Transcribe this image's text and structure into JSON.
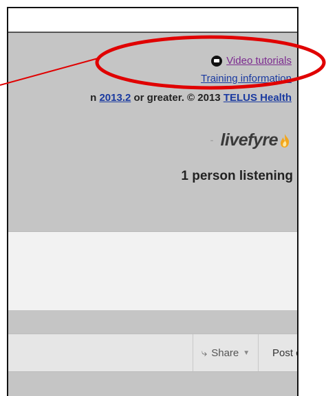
{
  "links": {
    "video_tutorials": "Video tutorials",
    "training_information": "Training information"
  },
  "copyright": {
    "prefix": "n ",
    "version_link": "2013.2",
    "middle": " or greater. © 2013 ",
    "company_link": "TELUS Health"
  },
  "livefyre": {
    "logo_text": "livefyre",
    "listening": "1 person listening"
  },
  "comment_bar": {
    "share_label": "Share",
    "post_label": "Post comment as..."
  },
  "colors": {
    "annotation_red": "#e00000",
    "panel_gray": "#c5c5c5",
    "link_blue": "#1a3aa0",
    "visited_purple": "#7b2a8f"
  },
  "icons": [
    "video-tutorial-icon",
    "livefyre-flame-icon",
    "share-icon",
    "caret-down-icon"
  ]
}
